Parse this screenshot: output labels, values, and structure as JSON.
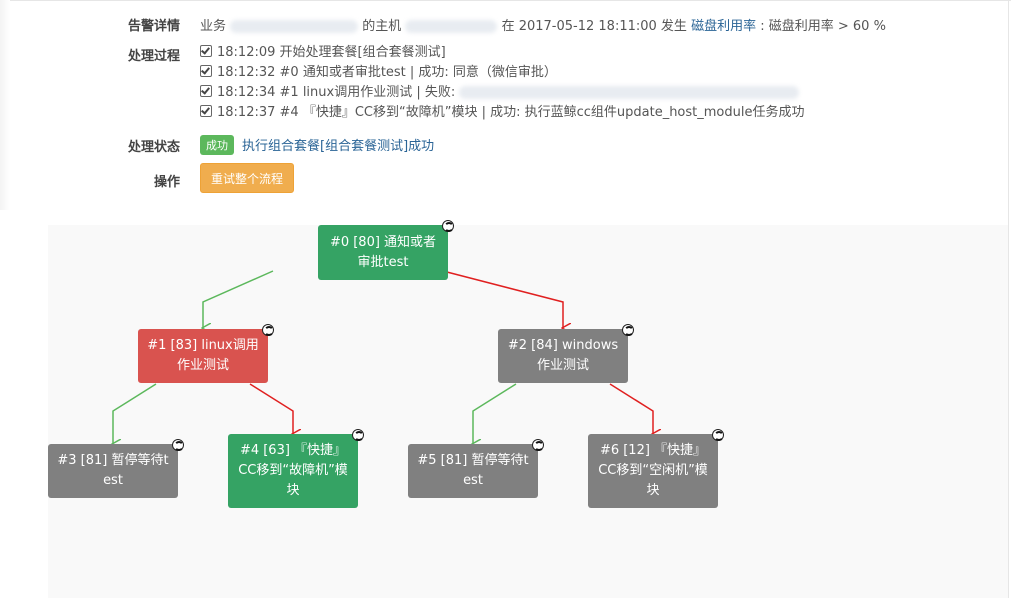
{
  "alert": {
    "label": "告警详情",
    "prefix": "业务",
    "host_text": "的主机",
    "at_text": "在 2017-05-12 18:11:00 发生",
    "metric_link": "磁盘利用率",
    "condition": ": 磁盘利用率 > 60 %"
  },
  "process": {
    "label": "处理过程",
    "lines": [
      "18:12:09 开始处理套餐[组合套餐测试]",
      "18:12:32 #0 通知或者审批test | 成功: 同意（微信审批）",
      "18:12:34 #1 linux调用作业测试 | 失败:",
      "18:12:37 #4 『快捷』CC移到“故障机”模块 | 成功: 执行蓝鲸cc组件update_host_module任务成功"
    ]
  },
  "status": {
    "label": "处理状态",
    "badge": "成功",
    "link": "执行组合套餐[组合套餐测试]成功"
  },
  "actions": {
    "label": "操作",
    "retry_button": "重试整个流程"
  },
  "flow": {
    "nodes": [
      {
        "id": "n0",
        "text": "#0 [80] 通知或者审批test",
        "status": "success"
      },
      {
        "id": "n1",
        "text": "#1 [83] linux调用作业测试",
        "status": "failed"
      },
      {
        "id": "n2",
        "text": "#2 [84] windows作业测试",
        "status": "skipped"
      },
      {
        "id": "n3",
        "text": "#3 [81] 暂停等待test",
        "status": "skipped"
      },
      {
        "id": "n4",
        "text": "#4 [63] 『快捷』CC移到“故障机”模块",
        "status": "success"
      },
      {
        "id": "n5",
        "text": "#5 [81] 暂停等待test",
        "status": "skipped"
      },
      {
        "id": "n6",
        "text": "#6 [12] 『快捷』CC移到“空闲机”模块",
        "status": "skipped"
      }
    ],
    "colors": {
      "success": "#35a364",
      "failed": "#d9534f",
      "skipped": "#808080",
      "edge_success": "#5cb85c",
      "edge_fail": "#e02020"
    }
  }
}
